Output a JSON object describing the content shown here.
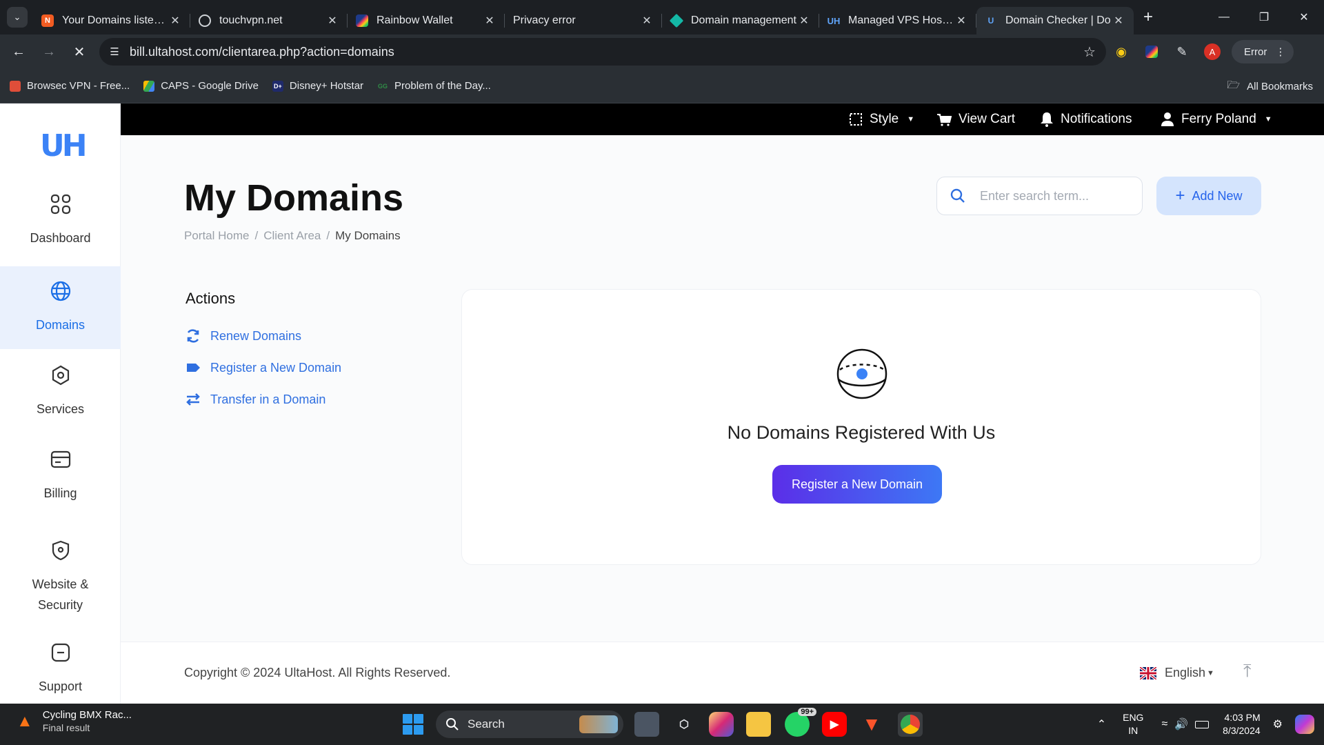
{
  "browser": {
    "tabs": [
      {
        "title": "Your Domains listed in",
        "favicon": "n-logo-icon",
        "color": "#f25c22",
        "letter": "N"
      },
      {
        "title": "touchvpn.net",
        "favicon": "globe-icon",
        "color": "#5f6368",
        "letter": ""
      },
      {
        "title": "Rainbow Wallet",
        "favicon": "rainbow-icon",
        "color": "#1e3a8a",
        "letter": ""
      },
      {
        "title": "Privacy error",
        "favicon": "none",
        "color": "",
        "letter": ""
      },
      {
        "title": "Domain management",
        "favicon": "diamond-icon",
        "color": "#14b8a6",
        "letter": ""
      },
      {
        "title": "Managed VPS Hosting",
        "favicon": "uh-logo-icon",
        "color": "#3b82f6",
        "letter": "UH"
      },
      {
        "title": "Domain Checker | Do",
        "favicon": "uh-logo-icon",
        "color": "#3b82f6",
        "letter": "U"
      }
    ],
    "active_tab": 6,
    "url": "bill.ultahost.com/clientarea.php?action=domains",
    "profile_letter": "A",
    "error_label": "Error",
    "bookmarks": [
      {
        "label": "Browsec VPN - Free...",
        "color": "#e04e39",
        "letter": ""
      },
      {
        "label": "CAPS - Google Drive",
        "color": "#34a853",
        "letter": ""
      },
      {
        "label": "Disney+ Hotstar",
        "color": "#1f2a6b",
        "letter": "D+"
      },
      {
        "label": "Problem of the Day...",
        "color": "#2f8d46",
        "letter": "GG"
      }
    ],
    "all_bookmarks": "All Bookmarks"
  },
  "sidebar": {
    "logo": "UH",
    "items": [
      {
        "label": "Dashboard",
        "icon": "grid-icon"
      },
      {
        "label": "Domains",
        "icon": "globe-icon"
      },
      {
        "label": "Services",
        "icon": "hexagon-icon"
      },
      {
        "label": "Billing",
        "icon": "card-icon"
      },
      {
        "label": "Website & Security",
        "icon": "shield-icon"
      },
      {
        "label": "Support",
        "icon": "support-icon"
      }
    ],
    "active": "Domains"
  },
  "topbar": {
    "style": "Style",
    "cart": "View Cart",
    "notifications": "Notifications",
    "user": "Ferry Poland"
  },
  "page": {
    "title": "My Domains",
    "breadcrumb": [
      "Portal Home",
      "Client Area",
      "My Domains"
    ],
    "search_placeholder": "Enter search term...",
    "add_new": "Add New",
    "actions_heading": "Actions",
    "actions": [
      {
        "label": "Renew Domains",
        "icon": "refresh-icon"
      },
      {
        "label": "Register a New Domain",
        "icon": "tag-icon"
      },
      {
        "label": "Transfer in a Domain",
        "icon": "transfer-icon"
      }
    ],
    "empty_message": "No Domains Registered With Us",
    "register_button": "Register a New Domain"
  },
  "footer": {
    "copyright": "Copyright © 2024 UltaHost. All Rights Reserved.",
    "language": "English"
  },
  "taskbar": {
    "weather_title": "Cycling BMX Rac...",
    "weather_sub": "Final result",
    "search": "Search",
    "whatsapp_badge": "99+",
    "lang_top": "ENG",
    "lang_bottom": "IN",
    "time": "4:03 PM",
    "date": "8/3/2024"
  },
  "colors": {
    "accent": "#3b82f6",
    "link": "#2f6fe0",
    "button_gradient_start": "#5b2ee8",
    "button_gradient_end": "#3d78f5",
    "sidebar_active_bg": "#eaf1fd"
  }
}
